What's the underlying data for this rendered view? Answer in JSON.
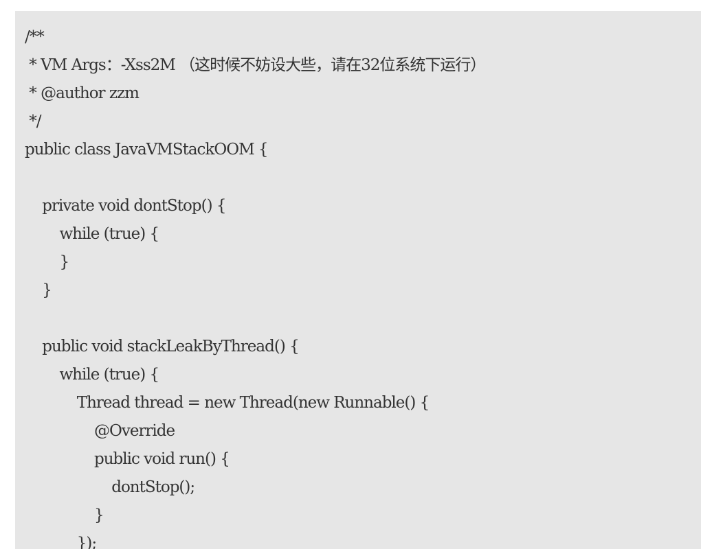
{
  "code": {
    "lines": [
      "/**",
      " * VM Args：-Xss2M （这时候不妨设大些，请在32位系统下运行）",
      " * @author zzm",
      " */",
      "public class JavaVMStackOOM {",
      "",
      "    private void dontStop() {",
      "        while (true) {",
      "        }",
      "    }",
      "",
      "    public void stackLeakByThread() {",
      "        while (true) {",
      "            Thread thread = new Thread(new Runnable() {",
      "                @Override",
      "                public void run() {",
      "                    dontStop();",
      "                }",
      "            });"
    ]
  }
}
